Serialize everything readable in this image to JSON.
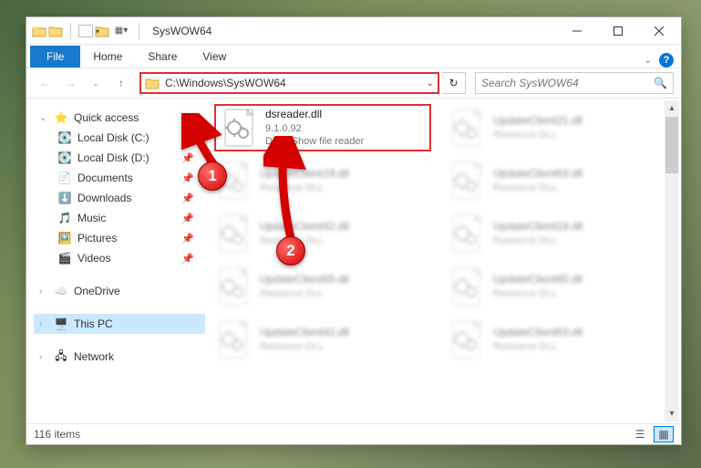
{
  "window": {
    "title": "SysWOW64"
  },
  "ribbon": {
    "file": "File",
    "home": "Home",
    "share": "Share",
    "view": "View"
  },
  "nav": {
    "address": "C:\\Windows\\SysWOW64",
    "search_placeholder": "Search SysWOW64"
  },
  "sidebar": {
    "quick_access": "Quick access",
    "local_c": "Local Disk (C:)",
    "local_d": "Local Disk (D:)",
    "documents": "Documents",
    "downloads": "Downloads",
    "music": "Music",
    "pictures": "Pictures",
    "videos": "Videos",
    "onedrive": "OneDrive",
    "this_pc": "This PC",
    "network": "Network"
  },
  "highlight_file": {
    "name": "dsreader.dll",
    "version": "9.1.0.92",
    "desc": "DirectShow file reader"
  },
  "blurred_files": [
    {
      "col": 1,
      "name": "UpdateClient19.dll",
      "desc": "Resource DLL"
    },
    {
      "col": 1,
      "name": "UpdateClient42.dll",
      "desc": "Resource DLL"
    },
    {
      "col": 1,
      "name": "UpdateClient65.dll",
      "desc": "Resource DLL"
    },
    {
      "col": 1,
      "name": "UpdateClient42.dll",
      "desc": "Resource DLL"
    },
    {
      "col": 2,
      "name": "UpdateClient21.dll",
      "desc": "Resource DLL"
    },
    {
      "col": 2,
      "name": "UpdateClient63.dll",
      "desc": "Resource DLL"
    },
    {
      "col": 2,
      "name": "UpdateClient19.dll",
      "desc": "Resource DLL"
    },
    {
      "col": 2,
      "name": "UpdateClient65.dll",
      "desc": "Resource DLL"
    },
    {
      "col": 2,
      "name": "UpdateClient63.dll",
      "desc": "Resource DLL"
    }
  ],
  "status": {
    "count": "116 items"
  },
  "callouts": {
    "one": "1",
    "two": "2"
  }
}
